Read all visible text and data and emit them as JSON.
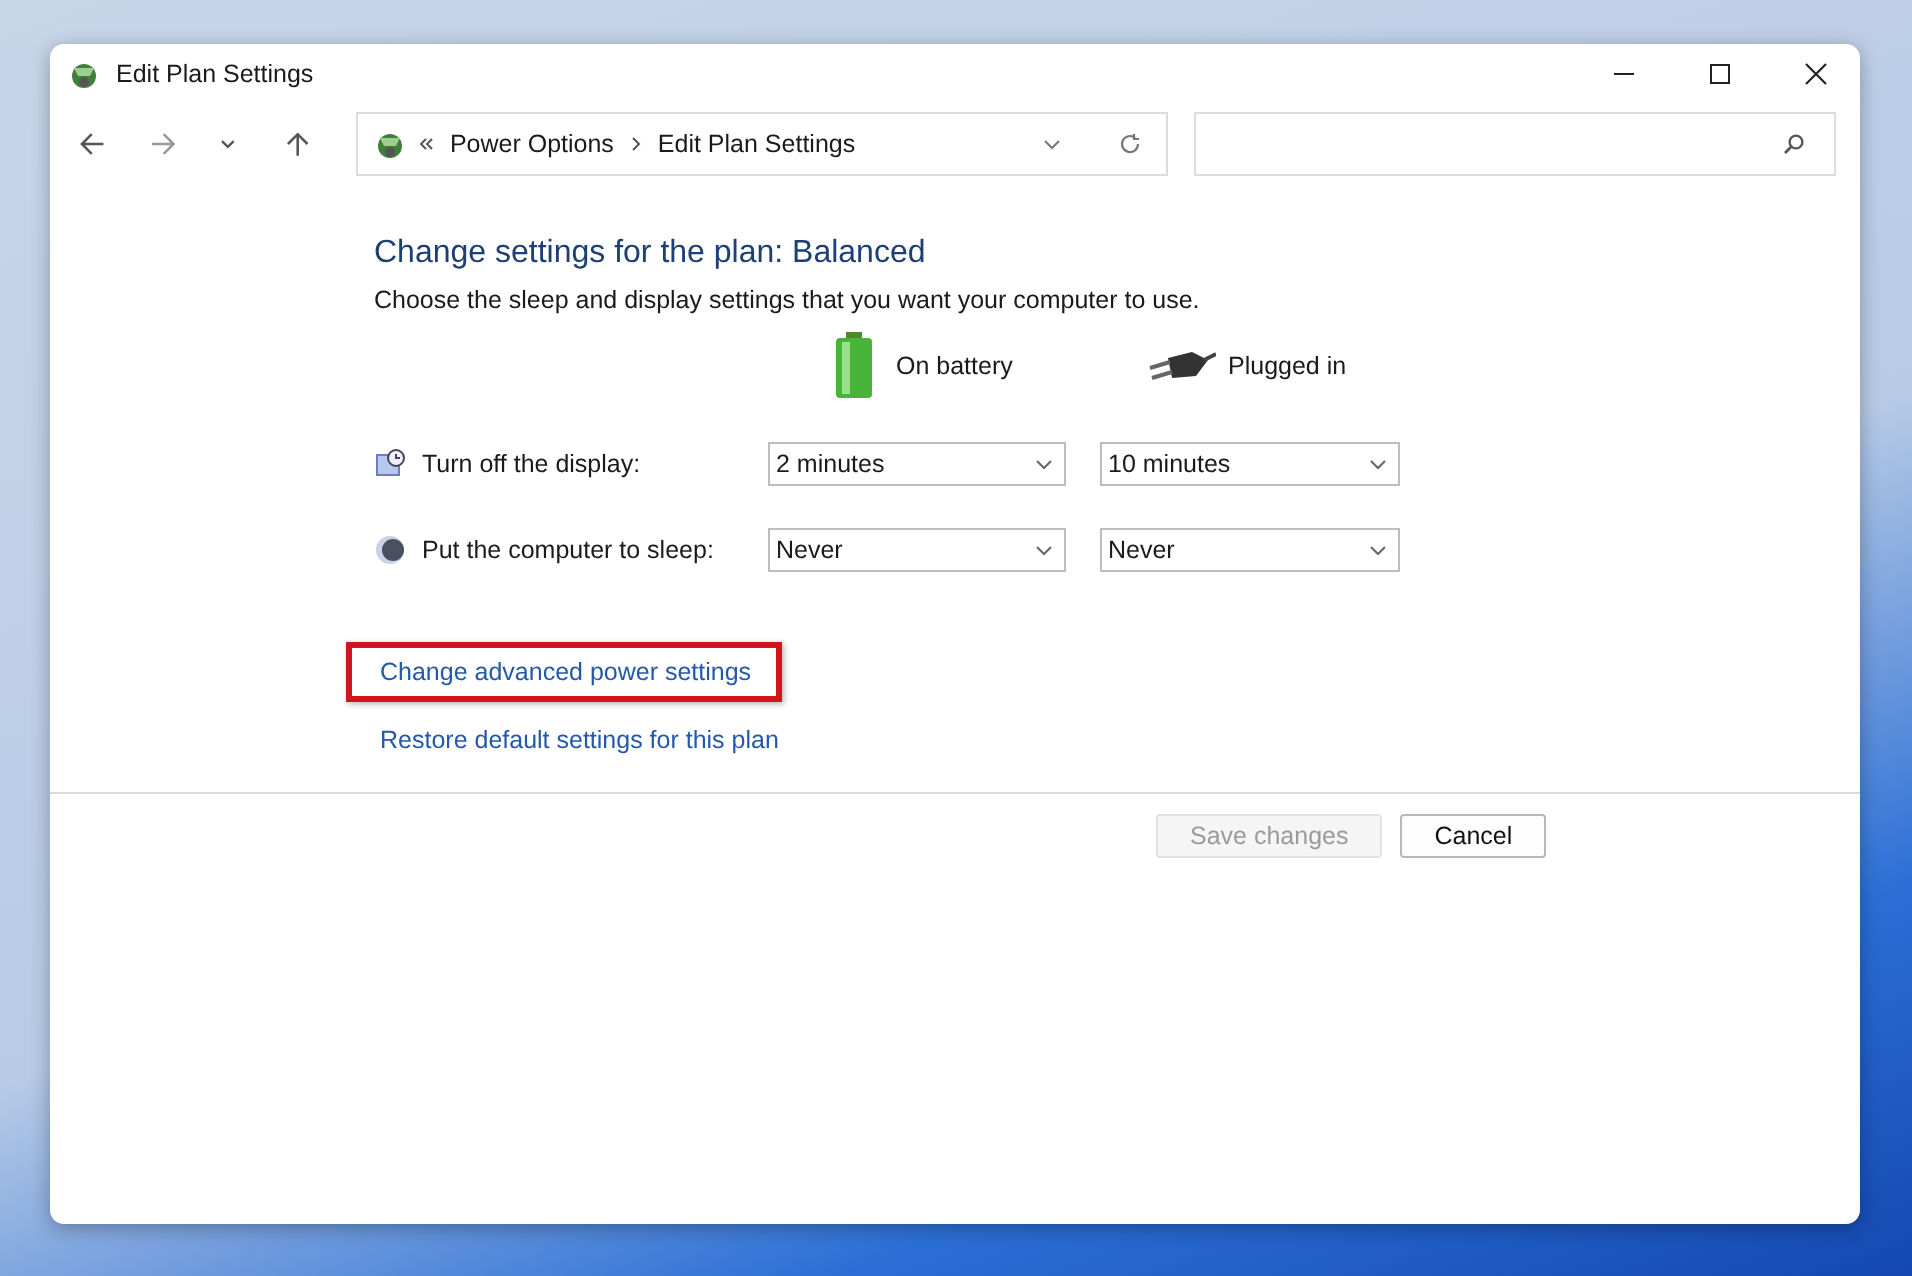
{
  "window": {
    "title": "Edit Plan Settings"
  },
  "address": {
    "crumbs": [
      "Power Options",
      "Edit Plan Settings"
    ]
  },
  "plan": {
    "heading": "Change settings for the plan: Balanced",
    "description": "Choose the sleep and display settings that you want your computer to use.",
    "columns": [
      {
        "label": "On battery",
        "kind": "battery"
      },
      {
        "label": "Plugged in",
        "kind": "plug"
      }
    ],
    "settings": [
      {
        "label": "Turn off the display:",
        "kind": "display",
        "values": [
          "2 minutes",
          "10 minutes"
        ]
      },
      {
        "label": "Put the computer to sleep:",
        "kind": "sleep",
        "values": [
          "Never",
          "Never"
        ]
      }
    ]
  },
  "links": [
    {
      "label": "Change advanced power settings",
      "highlighted": true
    },
    {
      "label": "Restore default settings for this plan",
      "highlighted": false
    }
  ],
  "buttons": [
    {
      "label": "Save changes",
      "disabled": true
    },
    {
      "label": "Cancel",
      "disabled": false
    }
  ]
}
